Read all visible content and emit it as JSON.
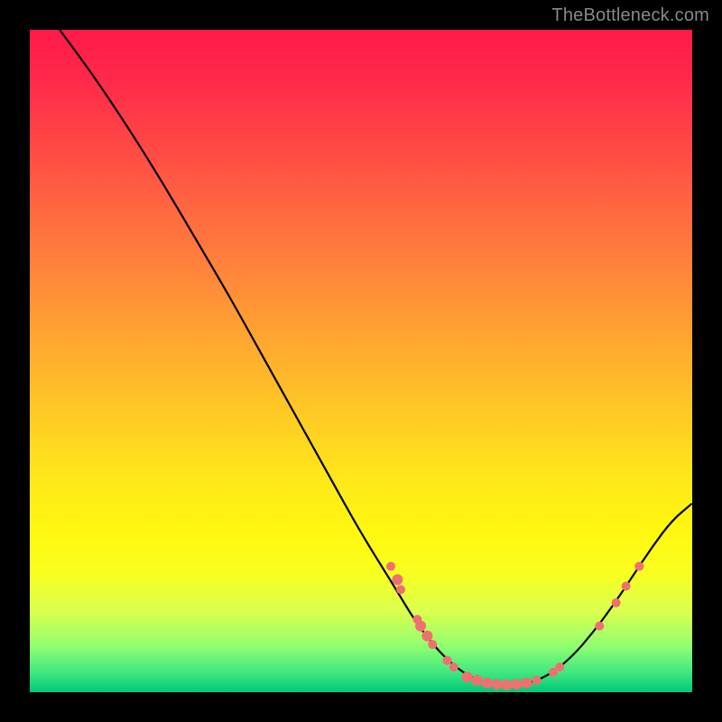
{
  "attribution": "TheBottleneck.com",
  "chart_data": {
    "type": "line",
    "title": "",
    "xlabel": "",
    "ylabel": "",
    "xlim": [
      0,
      100
    ],
    "ylim": [
      0,
      100
    ],
    "curve": [
      {
        "x": 4.5,
        "y": 100
      },
      {
        "x": 6,
        "y": 98
      },
      {
        "x": 10,
        "y": 92.5
      },
      {
        "x": 15,
        "y": 85
      },
      {
        "x": 20,
        "y": 77
      },
      {
        "x": 25,
        "y": 68.5
      },
      {
        "x": 30,
        "y": 60
      },
      {
        "x": 35,
        "y": 51
      },
      {
        "x": 40,
        "y": 42
      },
      {
        "x": 45,
        "y": 33
      },
      {
        "x": 50,
        "y": 24
      },
      {
        "x": 55,
        "y": 16
      },
      {
        "x": 58,
        "y": 11
      },
      {
        "x": 61,
        "y": 7
      },
      {
        "x": 64,
        "y": 4
      },
      {
        "x": 67,
        "y": 2
      },
      {
        "x": 70,
        "y": 1.2
      },
      {
        "x": 73,
        "y": 1
      },
      {
        "x": 76,
        "y": 1.5
      },
      {
        "x": 79,
        "y": 3
      },
      {
        "x": 82,
        "y": 5.5
      },
      {
        "x": 85,
        "y": 9
      },
      {
        "x": 88,
        "y": 13
      },
      {
        "x": 91,
        "y": 17.5
      },
      {
        "x": 94,
        "y": 22
      },
      {
        "x": 97,
        "y": 26
      },
      {
        "x": 100,
        "y": 28.5
      }
    ],
    "markers": [
      {
        "x": 54.5,
        "y": 19,
        "r": 5
      },
      {
        "x": 55.5,
        "y": 17,
        "r": 6
      },
      {
        "x": 56,
        "y": 15.5,
        "r": 5
      },
      {
        "x": 58.5,
        "y": 11,
        "r": 5
      },
      {
        "x": 59,
        "y": 10,
        "r": 6
      },
      {
        "x": 60,
        "y": 8.5,
        "r": 6
      },
      {
        "x": 60.8,
        "y": 7.2,
        "r": 5
      },
      {
        "x": 63,
        "y": 4.8,
        "r": 5
      },
      {
        "x": 64,
        "y": 3.8,
        "r": 5
      },
      {
        "x": 66,
        "y": 2.3,
        "r": 6
      },
      {
        "x": 67.5,
        "y": 1.8,
        "r": 6
      },
      {
        "x": 69,
        "y": 1.4,
        "r": 6
      },
      {
        "x": 70.5,
        "y": 1.2,
        "r": 6
      },
      {
        "x": 72,
        "y": 1.1,
        "r": 6
      },
      {
        "x": 73.5,
        "y": 1.2,
        "r": 6
      },
      {
        "x": 75,
        "y": 1.4,
        "r": 6
      },
      {
        "x": 76.5,
        "y": 1.8,
        "r": 5
      },
      {
        "x": 79,
        "y": 3,
        "r": 5
      },
      {
        "x": 80,
        "y": 3.8,
        "r": 5
      },
      {
        "x": 86,
        "y": 10,
        "r": 5
      },
      {
        "x": 88.5,
        "y": 13.5,
        "r": 5
      },
      {
        "x": 90,
        "y": 16,
        "r": 5
      },
      {
        "x": 92,
        "y": 19,
        "r": 5
      }
    ],
    "marker_color": "#ef7070"
  }
}
